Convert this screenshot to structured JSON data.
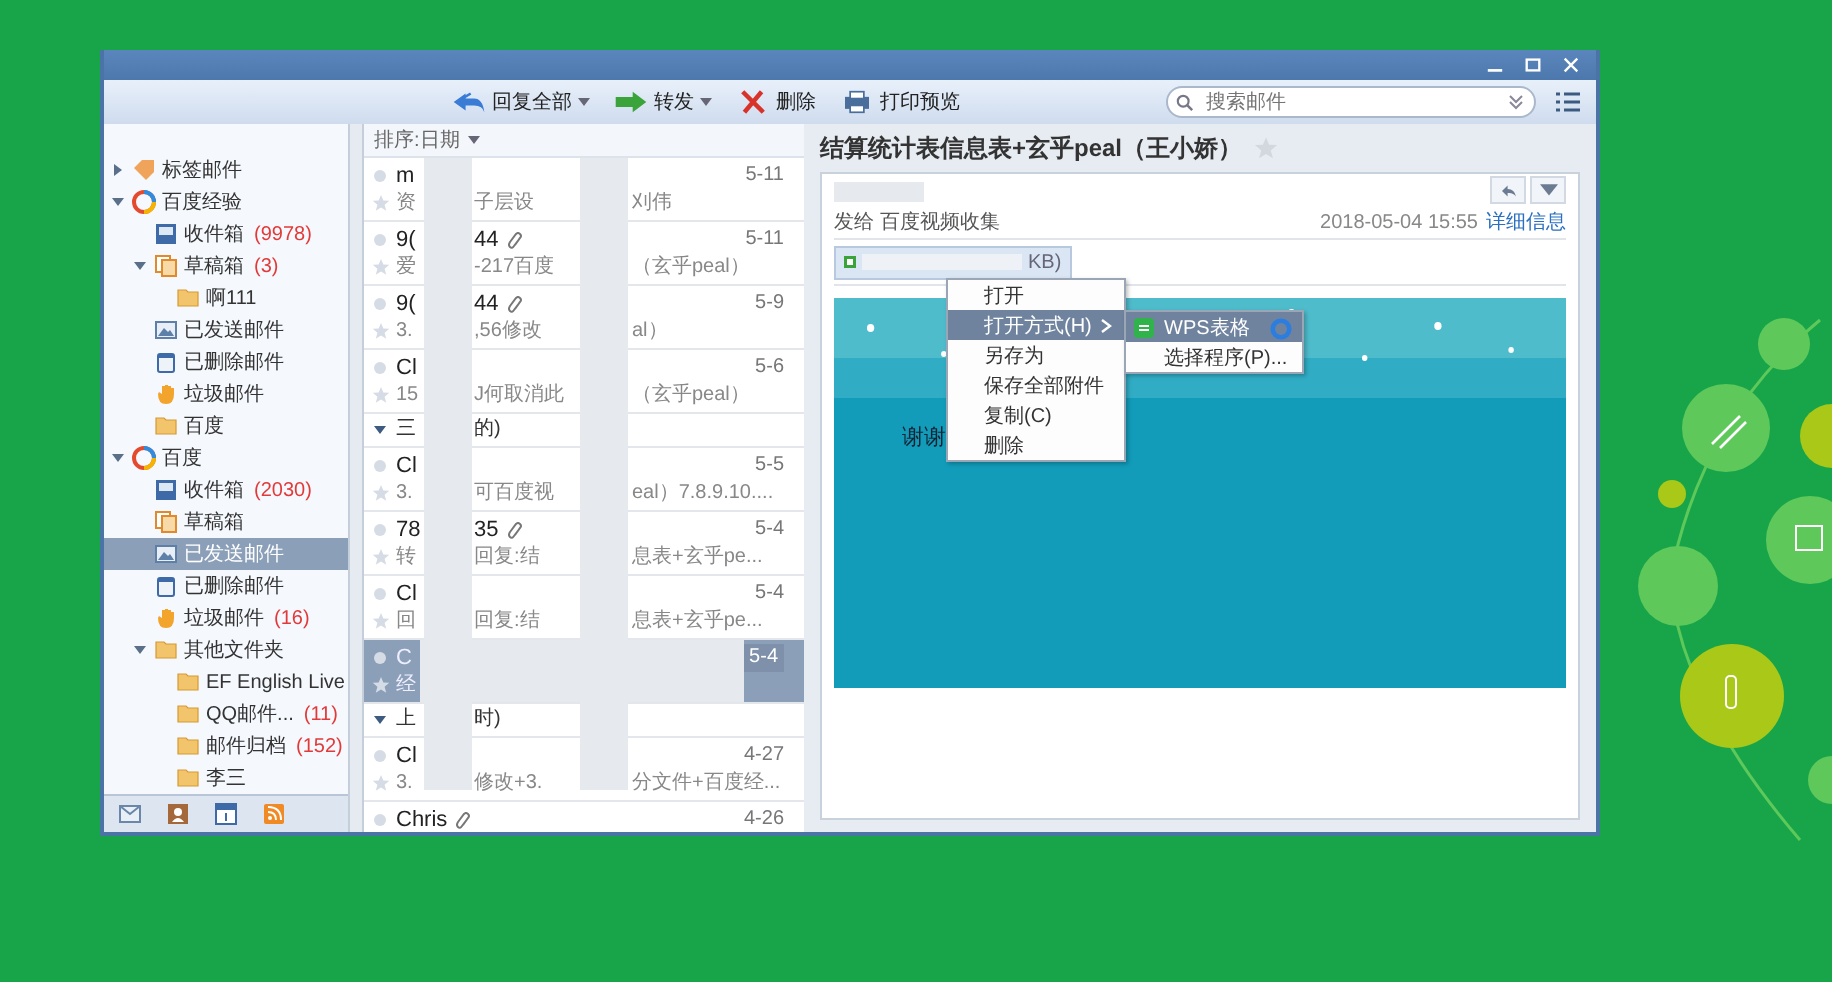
{
  "toolbar": {
    "buttons": [
      {
        "label": "回复全部",
        "kind": "reply-all",
        "dropdown": true
      },
      {
        "label": "转发",
        "kind": "forward",
        "dropdown": true
      },
      {
        "label": "删除",
        "kind": "delete",
        "dropdown": false
      },
      {
        "label": "打印预览",
        "kind": "print",
        "dropdown": false
      }
    ],
    "search": {
      "placeholder": "搜索邮件"
    }
  },
  "sidebar": {
    "items": [
      {
        "label": "标签邮件",
        "kind": "tag",
        "expanded": false,
        "selected": false
      },
      {
        "label": "百度经验",
        "kind": "account",
        "expanded": true,
        "selected": false,
        "children": [
          {
            "label": "收件箱",
            "count": "(9978)",
            "kind": "inbox",
            "selected": false
          },
          {
            "label": "草稿箱",
            "count": "(3)",
            "kind": "drafts",
            "expanded": true,
            "selected": false,
            "children": [
              {
                "label": "啊111",
                "kind": "folder",
                "selected": false
              }
            ]
          },
          {
            "label": "已发送邮件",
            "kind": "sent",
            "selected": false
          },
          {
            "label": "已删除邮件",
            "kind": "trash",
            "selected": false
          },
          {
            "label": "垃圾邮件",
            "kind": "spam",
            "selected": false
          },
          {
            "label": "百度",
            "kind": "folder",
            "selected": false
          }
        ]
      },
      {
        "label": "百度",
        "kind": "account",
        "expanded": true,
        "selected": false,
        "children": [
          {
            "label": "收件箱",
            "count": "(2030)",
            "kind": "inbox",
            "selected": false
          },
          {
            "label": "草稿箱",
            "kind": "drafts",
            "selected": false
          },
          {
            "label": "已发送邮件",
            "kind": "sent",
            "selected": true
          },
          {
            "label": "已删除邮件",
            "kind": "trash",
            "selected": false
          },
          {
            "label": "垃圾邮件",
            "count": "(16)",
            "kind": "spam",
            "selected": false
          },
          {
            "label": "其他文件夹",
            "kind": "folder",
            "expanded": true,
            "selected": false,
            "children": [
              {
                "label": "EF English Live",
                "kind": "folder",
                "selected": false
              },
              {
                "label": "QQ邮件...",
                "count": "(11)",
                "kind": "folder",
                "selected": false
              },
              {
                "label": "邮件归档",
                "count": "(152)",
                "kind": "folder",
                "selected": false
              },
              {
                "label": "李三",
                "kind": "folder",
                "selected": false
              }
            ]
          }
        ]
      }
    ]
  },
  "list": {
    "sort_label": "排序:日期",
    "entries": [
      {
        "kind": "mail",
        "sender": [
          "m"
        ],
        "attachment": false,
        "date": "5-11",
        "preview": [
          "资",
          "子层设",
          "刈伟"
        ],
        "selected": false
      },
      {
        "kind": "mail",
        "sender": [
          "9(",
          "44"
        ],
        "attachment": true,
        "date": "5-11",
        "preview": [
          "爱",
          "-217百度",
          "（玄乎peal）"
        ],
        "selected": false
      },
      {
        "kind": "mail",
        "sender": [
          "9(",
          "44"
        ],
        "attachment": true,
        "date": "5-9",
        "preview": [
          "3.",
          ",56修改",
          "al）"
        ],
        "selected": false
      },
      {
        "kind": "mail",
        "sender": [
          "Cl"
        ],
        "attachment": false,
        "date": "5-6",
        "preview": [
          "15",
          "J何取消此",
          "（玄乎peal）"
        ],
        "selected": false
      },
      {
        "kind": "group",
        "label": [
          "三",
          "的)"
        ],
        "expanded": true
      },
      {
        "kind": "mail",
        "sender": [
          "Cl"
        ],
        "attachment": false,
        "date": "5-5",
        "preview": [
          "3.",
          "可百度视",
          "eal）7.8.9.10...."
        ],
        "selected": false
      },
      {
        "kind": "mail",
        "sender": [
          "78",
          "35"
        ],
        "attachment": true,
        "date": "5-4",
        "preview": [
          "转",
          "回复:结",
          "息表+玄乎pe..."
        ],
        "selected": false
      },
      {
        "kind": "mail",
        "sender": [
          "Cl"
        ],
        "attachment": false,
        "date": "5-4",
        "preview": [
          "回",
          "回复:结",
          "息表+玄乎pe..."
        ],
        "selected": false
      },
      {
        "kind": "mail",
        "sender": [
          "C"
        ],
        "attachment": false,
        "date": "5-4",
        "preview": [
          "经"
        ],
        "selected": true
      },
      {
        "kind": "group",
        "label": [
          "上",
          "时)"
        ],
        "expanded": true
      },
      {
        "kind": "mail",
        "sender": [
          "Cl"
        ],
        "attachment": false,
        "date": "4-27",
        "preview": [
          "3.",
          "修改+3.",
          "分文件+百度经..."
        ],
        "selected": false
      },
      {
        "kind": "mail",
        "sender": [
          "Chris"
        ],
        "attachment": true,
        "date": "4-26",
        "selected": false
      }
    ]
  },
  "message": {
    "subject": "结算统计表信息表+玄乎peal（王小娇）",
    "starred": false,
    "recipient": "发给 百度视频收集",
    "date": "2018-05-04 15:55",
    "details_link": "详细信息",
    "attachment": {
      "size": "KB)"
    },
    "body_text": "谢谢"
  },
  "context_menu": {
    "items": [
      {
        "label": "打开",
        "selected": false,
        "submenu": false
      },
      {
        "label": "打开方式(H)",
        "selected": true,
        "submenu": true
      },
      {
        "label": "另存为",
        "selected": false,
        "submenu": false
      },
      {
        "label": "保存全部附件",
        "selected": false,
        "submenu": false
      },
      {
        "label": "复制(C)",
        "selected": false,
        "submenu": false
      },
      {
        "label": "删除",
        "selected": false,
        "submenu": false
      }
    ],
    "submenu": [
      {
        "label": "WPS表格",
        "kind": "wps",
        "selected": true
      },
      {
        "label": "选择程序(P)...",
        "kind": "plain",
        "selected": false
      }
    ]
  }
}
